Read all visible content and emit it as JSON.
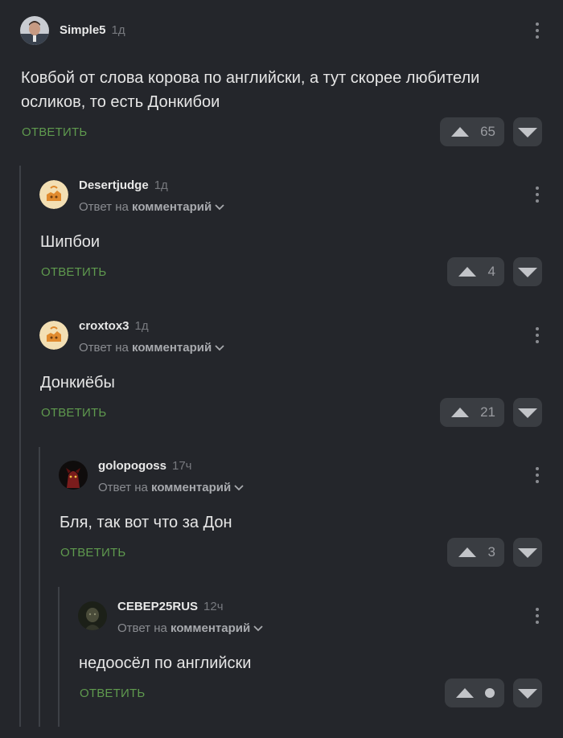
{
  "reply_prefix": "Ответ на",
  "reply_target": "комментарий",
  "reply_label": "ОТВЕТИТЬ",
  "comments": [
    {
      "user": "Simple5",
      "time": "1д",
      "text": "Ковбой от слова корова по английски, а тут скорее любители осликов, то есть Донкибои",
      "rating": "65"
    },
    {
      "user": "Desertjudge",
      "time": "1д",
      "text": "Шипбои",
      "rating": "4"
    },
    {
      "user": "croxtox3",
      "time": "1д",
      "text": "Донкиёбы",
      "rating": "21"
    },
    {
      "user": "golopogoss",
      "time": "17ч",
      "text": "Бля, так вот что за Дон",
      "rating": "3"
    },
    {
      "user": "СЕВЕР25RUS",
      "time": "12ч",
      "text": "недоосёл по английски",
      "rating": ""
    }
  ],
  "colors": {
    "background": "#24262b",
    "accent_green": "#5f9a4e",
    "button_bg": "#3a3d42"
  },
  "icons": [
    "kebab-menu-icon",
    "chevron-down-icon",
    "arrow-up-icon",
    "arrow-down-icon",
    "avatar-placeholder-icon"
  ]
}
